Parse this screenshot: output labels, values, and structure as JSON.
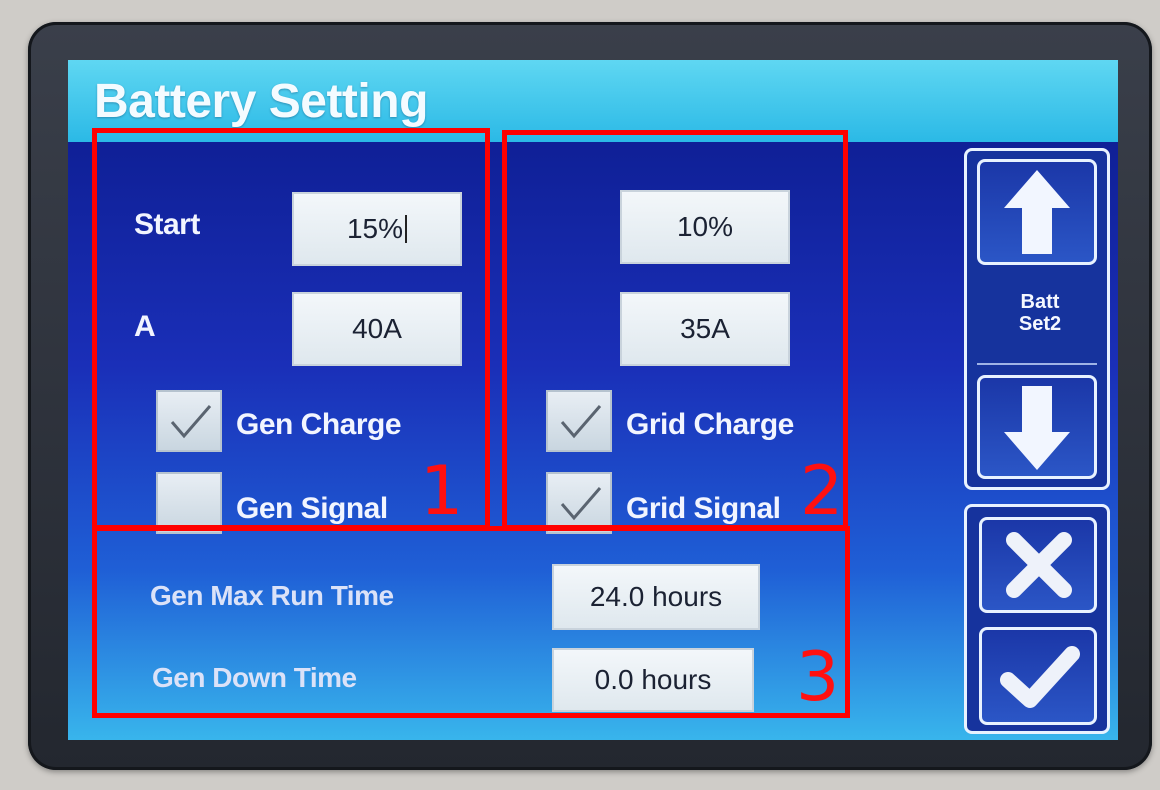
{
  "screen": {
    "title": "Battery Setting"
  },
  "group1": {
    "start_label": "Start",
    "start_value": "15%",
    "amp_label": "A",
    "amp_value": "40A",
    "charge_label": "Gen Charge",
    "charge_checked": true,
    "signal_label": "Gen Signal",
    "signal_checked": false
  },
  "group2": {
    "start_value": "10%",
    "amp_value": "35A",
    "charge_label": "Grid Charge",
    "charge_checked": true,
    "signal_label": "Grid Signal",
    "signal_checked": true
  },
  "group3": {
    "max_run_label": "Gen Max Run Time",
    "max_run_value": "24.0 hours",
    "down_time_label": "Gen Down Time",
    "down_time_value": "0.0 hours"
  },
  "side": {
    "page_label_line1": "Batt",
    "page_label_line2": "Set2",
    "up_icon": "arrow-up-icon",
    "down_icon": "arrow-down-icon",
    "cancel_icon": "x-icon",
    "confirm_icon": "check-icon"
  },
  "annotations": [
    "1",
    "2",
    "3"
  ],
  "colors": {
    "title_bar": "#2bb9e6",
    "screen_top": "#0b1a8a",
    "screen_bottom": "#38b5ec",
    "annotation_red": "#ff0000"
  }
}
